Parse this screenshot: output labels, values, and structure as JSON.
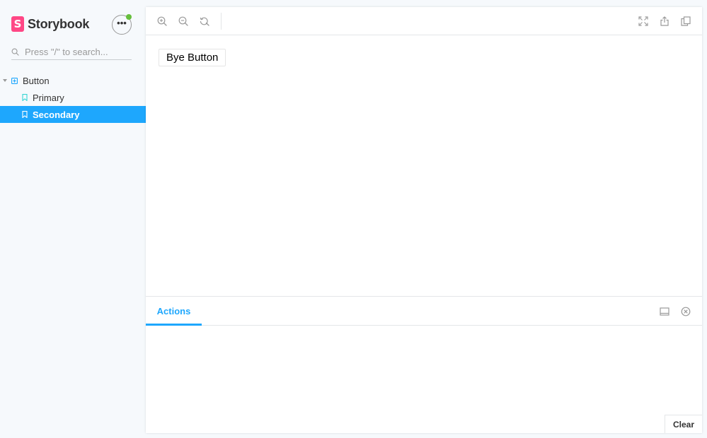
{
  "brand": {
    "logo_letter": "S",
    "name": "Storybook",
    "logo_color": "#ff4785",
    "menu_label": "•••",
    "status_color": "#66bf3c"
  },
  "search": {
    "placeholder": "Press \"/\" to search..."
  },
  "tree": {
    "component": {
      "label": "Button",
      "icon": "component-icon"
    },
    "stories": [
      {
        "label": "Primary",
        "icon": "bookmark-icon",
        "selected": false
      },
      {
        "label": "Secondary",
        "icon": "bookmark-icon",
        "selected": true
      }
    ],
    "accent": "#1ea7fd"
  },
  "toolbar": {
    "left": [
      "zoom-in-icon",
      "zoom-out-icon",
      "zoom-reset-icon"
    ],
    "right": [
      "fullscreen-icon",
      "share-icon",
      "copy-icon"
    ]
  },
  "canvas": {
    "button_label": "Bye Button"
  },
  "addons": {
    "tabs": [
      {
        "label": "Actions",
        "active": true
      }
    ],
    "tools": [
      "panel-orientation-icon",
      "close-panel-icon"
    ],
    "clear_label": "Clear"
  }
}
